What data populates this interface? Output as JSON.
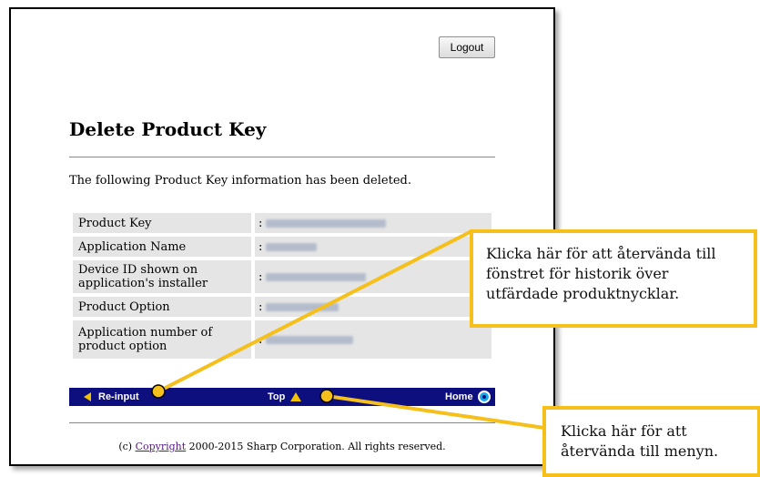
{
  "header": {
    "logout_label": "Logout"
  },
  "page": {
    "title": "Delete Product Key",
    "message": "The following Product Key information has been deleted."
  },
  "info_rows": [
    {
      "label": "Product Key",
      "value": ":"
    },
    {
      "label": "Application Name",
      "value": ":"
    },
    {
      "label": "Device ID shown on application's installer",
      "value": ":"
    },
    {
      "label": "Product Option",
      "value": ":"
    },
    {
      "label": "Application number of product option",
      "value": ":"
    }
  ],
  "navbar": {
    "reinput_label": "Re-input",
    "top_label": "Top",
    "home_label": "Home"
  },
  "footer": {
    "prefix": "(c) ",
    "link": "Copyright",
    "suffix": " 2000-2015 Sharp Corporation. All rights reserved."
  },
  "callouts": {
    "history": "Klicka här för att återvända till fönstret för historik över utfärdade produktnycklar.",
    "menu": "Klicka här för att återvända till menyn."
  },
  "colors": {
    "navbar": "#0e0f7e",
    "accent": "#f5bf1c"
  },
  "icons": {
    "reinput": "triangle-left-icon",
    "top": "triangle-up-icon",
    "home": "home-circle-icon"
  }
}
